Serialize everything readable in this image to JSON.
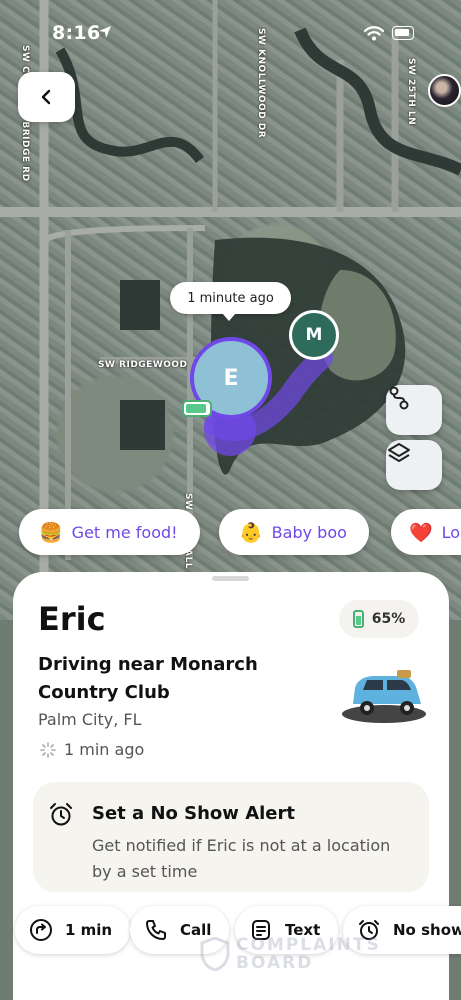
{
  "status_bar": {
    "time": "8:16"
  },
  "map": {
    "streets": [
      "SW COUNTRY BRIDGE RD",
      "SW KNOLLWOOD DR",
      "SW 25TH LN",
      "SW RIDGEWOOD",
      "SW OVERFALL"
    ],
    "time_bubble": "1 minute ago",
    "pins": [
      {
        "initial": "E",
        "color": "#8fc1d6",
        "ring": "#7048e8"
      },
      {
        "initial": "M",
        "color": "#2e6b5b"
      }
    ],
    "controls": [
      "route-icon",
      "layers-icon"
    ]
  },
  "chips": [
    {
      "emoji": "🍔",
      "label": "Get me food!"
    },
    {
      "emoji": "👶",
      "label": "Baby boo"
    },
    {
      "emoji": "❤️",
      "label": "Lo"
    }
  ],
  "card": {
    "name": "Eric",
    "battery": "65%",
    "status": "Driving near Monarch Country Club",
    "place": "Palm City, FL",
    "updated": "1 min ago",
    "alert": {
      "title": "Set a No Show Alert",
      "description": "Get notified if Eric is not at a location by a set time"
    }
  },
  "actions": [
    {
      "icon": "directions-icon",
      "label": "1 min"
    },
    {
      "icon": "phone-icon",
      "label": "Call"
    },
    {
      "icon": "message-icon",
      "label": "Text"
    },
    {
      "icon": "alarm-icon",
      "label": "No show"
    }
  ],
  "watermark": {
    "line1": "COMPLAINTS",
    "line2": "BOARD"
  },
  "colors": {
    "accent": "#7048e8",
    "battery": "#56c98b",
    "card_bg": "#ffffff",
    "alert_bg": "#f6f4ee"
  }
}
